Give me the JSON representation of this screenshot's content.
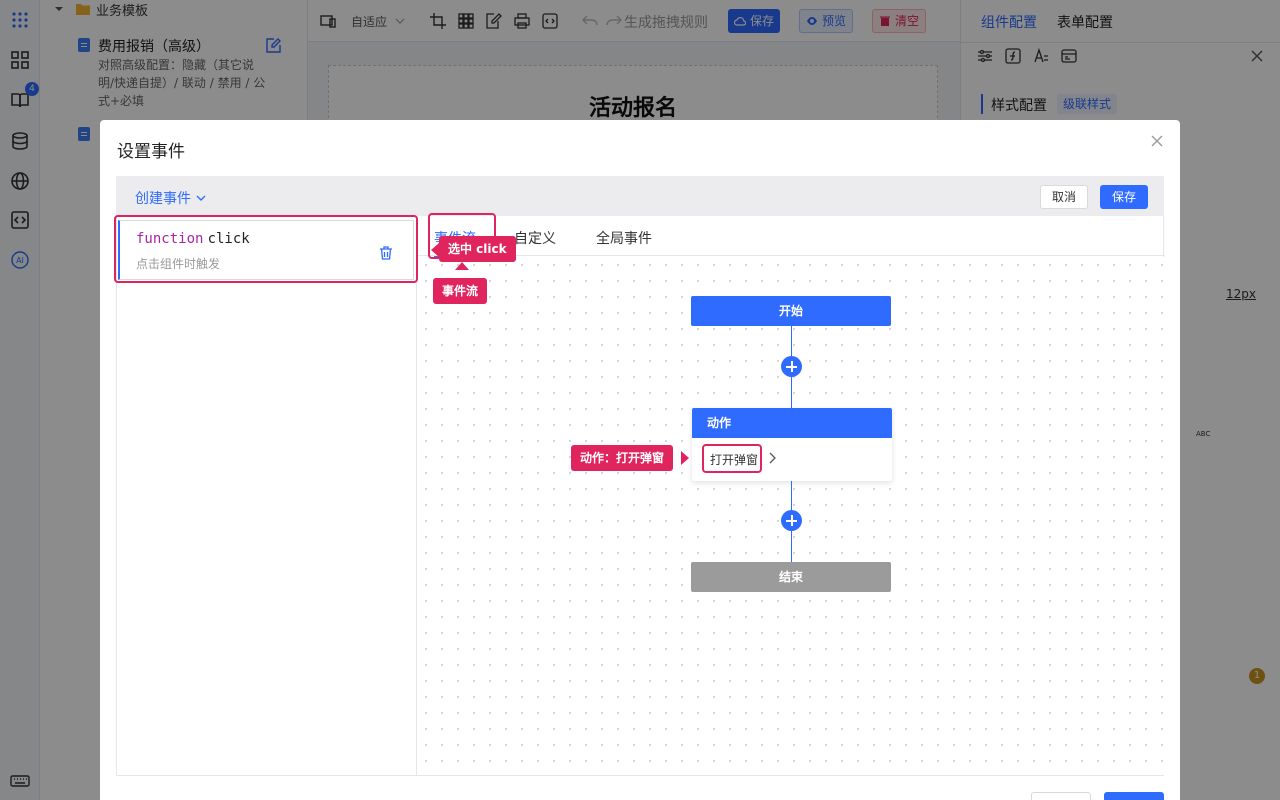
{
  "sidebar": {
    "folder_label": "业务模板",
    "notification_count": "4",
    "template": {
      "title": "费用报销（高级）",
      "desc": "对照高级配置：隐藏（其它说明/快递自提）/ 联动 / 禁用 / 公式+必填"
    }
  },
  "toolbar": {
    "layout_label": "自适应",
    "gen_rule_label": "生成拖拽规则",
    "save_label": "保存",
    "preview_label": "预览",
    "clear_label": "清空"
  },
  "canvas": {
    "form_title": "活动报名"
  },
  "right_panel": {
    "tab_component": "组件配置",
    "tab_form": "表单配置",
    "section_style": "样式配置",
    "cascade_style": "级联样式",
    "size_value": "12px",
    "abc_label": "ABC",
    "warning_count": "1"
  },
  "modal": {
    "title": "设置事件",
    "create_event_label": "创建事件",
    "cancel_label": "取消",
    "save_label": "保存",
    "event": {
      "keyword": "function",
      "name": "click",
      "desc": "点击组件时触发"
    },
    "tabs": [
      "事件流",
      "自定义",
      "全局事件"
    ],
    "flow": {
      "start_label": "开始",
      "action_title": "动作",
      "action_item": "打开弹窗",
      "end_label": "结束"
    }
  },
  "annotations": {
    "select_click": "选中 click",
    "event_flow": "事件流",
    "action_open": "动作：打开弹窗"
  },
  "colors": {
    "primary": "#2f6bff",
    "danger": "#e0245e",
    "end_node": "#9b9b9b"
  }
}
